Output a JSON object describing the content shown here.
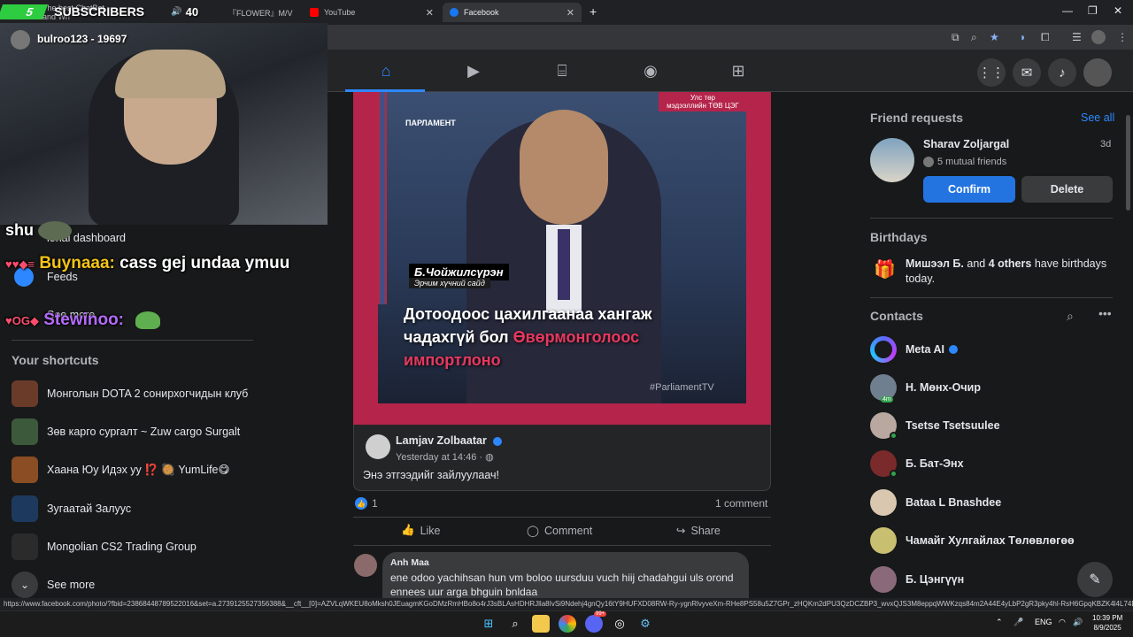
{
  "browser": {
    "tabs": [
      {
        "label": "The best ChatBot and Wri"
      },
      {
        "label": "『FLOWER』M/V"
      },
      {
        "label": "YouTube"
      },
      {
        "label": "Facebook"
      }
    ],
    "new_tab": "+",
    "status_url": "https://www.facebook.com/photo/?fbid=23868448789522016&set=a.2739125527356388&__cft__[0]=AZVLqWKEU8oMksh0JEuagmKGoDMzRmHBo8o4rJ3sBLAsHDHRJlla8IvSi9Ndehj4gnQy16tY9HUFXD08RW-Ry-ygnRlvyveXm-RHe8PS58u5Z7GPr_zHQKm2dPU3QzDCZBP3_wvxQJS3M8eppqWWKzqs84m2A44E4yLbP2gR3pky4hl-RsH6GpqKBZK4l4L74Dfoek..."
  },
  "stream": {
    "subs_count": "5",
    "subs_label": "SUBSCRIBERS",
    "viewers": "40",
    "streamer_tag": "bulroo123 - 19697",
    "chat": [
      {
        "text": "shu"
      },
      {
        "user": "Buynaaa:",
        "msg": "cass gej undaa ymuu"
      },
      {
        "user": "Stewinoo:",
        "msg": ""
      }
    ]
  },
  "left": {
    "partial_items": [
      "ional dashboard",
      "Feeds",
      "See more"
    ],
    "shortcuts_heading": "Your shortcuts",
    "shortcuts": [
      {
        "label": "Монголын DOTA 2 сонирхогчидын клуб",
        "color": "#6b3b2a"
      },
      {
        "label": "Зөв карго сургалт ~ Zuw cargo Surgalt",
        "color": "#3c5a3b"
      },
      {
        "label": "Хаана Юу Идэх уу ⁉️ 🥘 YumLife😋",
        "color": "#8a4d24"
      },
      {
        "label": "Зугаатай Залуус",
        "color": "#1d3a5e"
      },
      {
        "label": "Mongolian CS2 Trading Group",
        "color": "#2b2b2b"
      }
    ],
    "see_more": "See more"
  },
  "post": {
    "image_caption_name": "Б.Чойжилсүрэн",
    "image_caption_role": "Эрчим хүчний сайд",
    "headline_1": "Дотоодоос цахилгаанаа хангаж",
    "headline_2a": "чадахгүй бол ",
    "headline_2b": "Өвөрмонголоос",
    "headline_3": "импортлоно",
    "parliament_label": "ПАРЛАМЕНТ",
    "corner_label_1": "Улс төр",
    "corner_label_2": "мэдээллийн ТӨВ ЦЭГ",
    "hashtag": "#ParliamentTV",
    "author": "Lamjav Zolbaatar",
    "time": "Yesterday at 14:46 ·",
    "text": "Энэ этгээдийг зайлуулаач!",
    "likes": "1",
    "comments": "1 comment",
    "like_label": "Like",
    "comment_label": "Comment",
    "share_label": "Share",
    "comment": {
      "author": "Anh Maa",
      "text": "ene odoo yachihsan hun vm boloo uursduu vuch hiij chadahgui uls orond ennees uur arga bhguin bnldaa"
    }
  },
  "right": {
    "friend_requests_title": "Friend requests",
    "see_all": "See all",
    "request": {
      "name": "Sharav Zoljargal",
      "age": "3d",
      "mutual": "5 mutual friends",
      "confirm": "Confirm",
      "delete": "Delete"
    },
    "birthdays_title": "Birthdays",
    "birthday_name": "Мишээл Б.",
    "birthday_and": " and ",
    "birthday_others": "4 others",
    "birthday_rest": " have birthdays today.",
    "contacts_title": "Contacts",
    "contacts": [
      {
        "name": "Meta AI",
        "color": "#5b6cff",
        "online": false
      },
      {
        "name": "Н. Мөнх-Очир",
        "color": "#6f7f8f",
        "online": false,
        "badge": "4m"
      },
      {
        "name": "Tsetse Tsetsuulee",
        "color": "#b8a8a0",
        "online": true
      },
      {
        "name": "Б. Бат-Энх",
        "color": "#7a2a2a",
        "online": true
      },
      {
        "name": "Bataa L Bnashdee",
        "color": "#d9c7b0",
        "online": false
      },
      {
        "name": "Чамайг Хулгайлах Төлөвлөгөө",
        "color": "#c8c070",
        "online": false
      },
      {
        "name": "Б. Цэнгүүн",
        "color": "#8a6a7a",
        "online": false
      }
    ]
  },
  "taskbar": {
    "lang": "ENG",
    "time": "10:39 PM",
    "date": "8/9/2025",
    "badge": "99+"
  }
}
